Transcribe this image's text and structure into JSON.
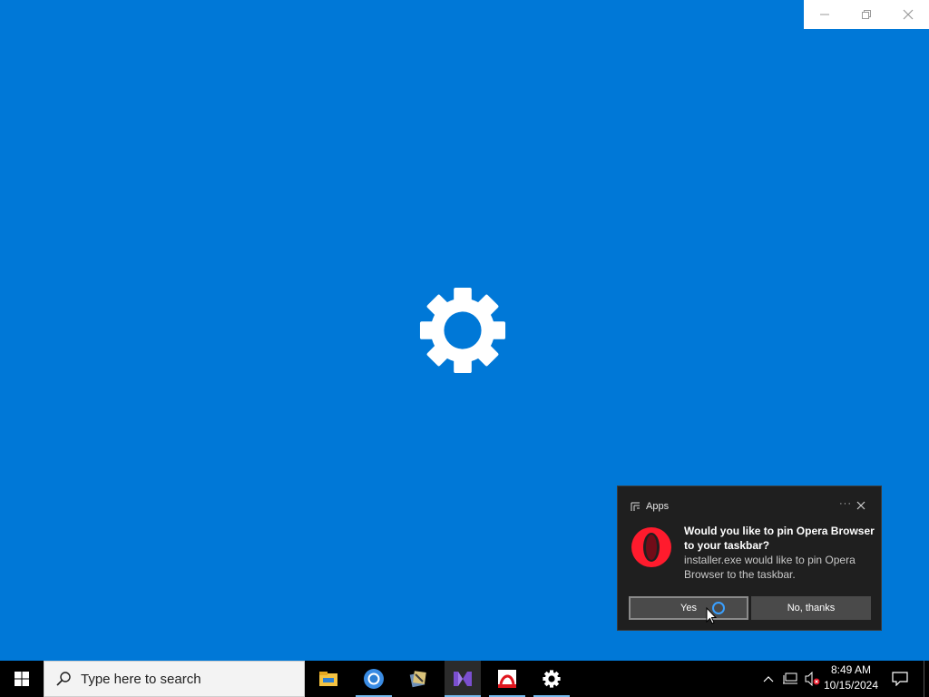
{
  "desktop": {
    "background_color": "#0078d7"
  },
  "window_controls": {
    "icons": [
      "minimize-icon",
      "restore-icon",
      "close-icon"
    ]
  },
  "splash": {
    "icon": "gear-icon"
  },
  "toast": {
    "app_name": "Apps",
    "more_label": "···",
    "title": "Would you like to pin Opera Browser to your taskbar?",
    "body": "installer.exe would like to pin Opera Browser to the taskbar.",
    "yes_label": "Yes",
    "no_label": "No, thanks",
    "logo_icon": "opera-logo-icon",
    "accent": "#ff1b2d"
  },
  "taskbar": {
    "search_placeholder": "Type here to search",
    "pinned_apps": [
      "file-explorer-icon",
      "chrome-icon",
      "app-icon",
      "visual-studio-icon",
      "adobe-reader-icon",
      "settings-icon"
    ],
    "clock_time": "8:49 AM",
    "clock_date": "10/15/2024",
    "accent_underline": "#76b9ed"
  }
}
